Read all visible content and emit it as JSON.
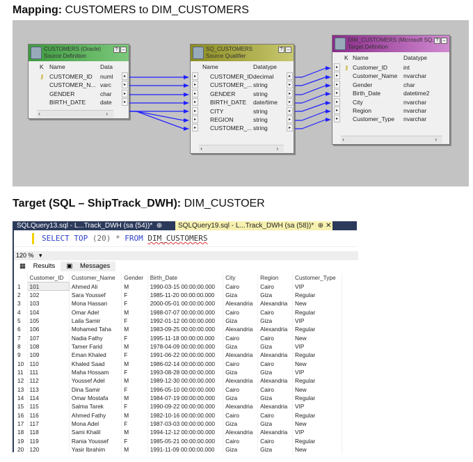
{
  "headings": {
    "mapping_label": "Mapping:",
    "mapping_text": " CUSTOMERS to DIM_CUSTOMERS",
    "target_label": "Target (SQL – ShipTrack_DWH):",
    "target_text": " DIM_CUSTOER"
  },
  "source": {
    "title": "CUSTOMERS (Oracle)",
    "subtitle": "Source Definition",
    "col_k": "K",
    "col_name": "Name",
    "col_type": "Data",
    "rows": [
      {
        "name": "CUSTOMER_ID",
        "type": "numl",
        "key": true
      },
      {
        "name": "CUSTOMER_N...",
        "type": "varc"
      },
      {
        "name": "GENDER",
        "type": "char"
      },
      {
        "name": "BIRTH_DATE",
        "type": "date"
      }
    ]
  },
  "qualifier": {
    "title": "SQ_CUSTOMERS",
    "subtitle": "Source Qualifier",
    "col_name": "Name",
    "col_type": "Datatype",
    "rows": [
      {
        "name": "CUSTOMER_ID",
        "type": "decimal"
      },
      {
        "name": "CUSTOMER_...",
        "type": "string"
      },
      {
        "name": "GENDER",
        "type": "string"
      },
      {
        "name": "BIRTH_DATE",
        "type": "date/time"
      },
      {
        "name": "CITY",
        "type": "string"
      },
      {
        "name": "REGION",
        "type": "string"
      },
      {
        "name": "CUSTOMER_...",
        "type": "string"
      }
    ]
  },
  "target": {
    "title": "DIM_CUSTOMERS (Microsoft SQ...",
    "subtitle": "Target Definition",
    "col_k": "K",
    "col_name": "Name",
    "col_type": "Datatype",
    "rows": [
      {
        "name": "Customer_ID",
        "type": "int",
        "key": true
      },
      {
        "name": "Customer_Name",
        "type": "nvarchar"
      },
      {
        "name": "Gender",
        "type": "char"
      },
      {
        "name": "Birth_Date",
        "type": "datetime2"
      },
      {
        "name": "City",
        "type": "nvarchar"
      },
      {
        "name": "Region",
        "type": "nvarchar"
      },
      {
        "name": "Customer_Type",
        "type": "nvarchar"
      }
    ]
  },
  "ssms": {
    "tab1": "SQLQuery13.sql - L...Track_DWH (sa (54))*",
    "tab2": "SQLQuery19.sql - L...Track_DWH (sa (58))*",
    "query": {
      "k1": "SELECT",
      "k2": "TOP",
      "n": "(20)",
      "star": "*",
      "k3": "FROM",
      "obj": "DIM_CUSTOMERS"
    },
    "zoom": "120 %",
    "results_tab": "Results",
    "messages_tab": "Messages",
    "columns": [
      "",
      "Customer_ID",
      "Customer_Name",
      "Gender",
      "Birth_Date",
      "City",
      "Region",
      "Customer_Type"
    ],
    "rows": [
      [
        "1",
        "101",
        "Ahmed Ali",
        "M",
        "1990-03-15 00:00:00.000",
        "Cairo",
        "Cairo",
        "VIP"
      ],
      [
        "2",
        "102",
        "Sara Youssef",
        "F",
        "1985-11-20 00:00:00.000",
        "Giza",
        "Giza",
        "Regular"
      ],
      [
        "3",
        "103",
        "Mona Hassan",
        "F",
        "2000-05-01 00:00:00.000",
        "Alexandria",
        "Alexandria",
        "New"
      ],
      [
        "4",
        "104",
        "Omar Adel",
        "M",
        "1988-07-07 00:00:00.000",
        "Cairo",
        "Cairo",
        "Regular"
      ],
      [
        "5",
        "105",
        "Laila Samir",
        "F",
        "1992-01-12 00:00:00.000",
        "Giza",
        "Giza",
        "VIP"
      ],
      [
        "6",
        "106",
        "Mohamed Taha",
        "M",
        "1983-09-25 00:00:00.000",
        "Alexandria",
        "Alexandria",
        "Regular"
      ],
      [
        "7",
        "107",
        "Nadia Fathy",
        "F",
        "1995-11-18 00:00:00.000",
        "Cairo",
        "Cairo",
        "New"
      ],
      [
        "8",
        "108",
        "Tamer Farid",
        "M",
        "1978-04-09 00:00:00.000",
        "Giza",
        "Giza",
        "VIP"
      ],
      [
        "9",
        "109",
        "Eman Khaled",
        "F",
        "1991-06-22 00:00:00.000",
        "Alexandria",
        "Alexandria",
        "Regular"
      ],
      [
        "10",
        "110",
        "Khaled Saad",
        "M",
        "1986-02-14 00:00:00.000",
        "Cairo",
        "Cairo",
        "New"
      ],
      [
        "11",
        "111",
        "Maha Hossam",
        "F",
        "1993-08-28 00:00:00.000",
        "Giza",
        "Giza",
        "VIP"
      ],
      [
        "12",
        "112",
        "Youssef Adel",
        "M",
        "1989-12-30 00:00:00.000",
        "Alexandria",
        "Alexandria",
        "Regular"
      ],
      [
        "13",
        "113",
        "Dina Samir",
        "F",
        "1996-05-10 00:00:00.000",
        "Cairo",
        "Cairo",
        "New"
      ],
      [
        "14",
        "114",
        "Omar Mostafa",
        "M",
        "1984-07-19 00:00:00.000",
        "Giza",
        "Giza",
        "Regular"
      ],
      [
        "15",
        "115",
        "Salma Tarek",
        "F",
        "1990-09-22 00:00:00.000",
        "Alexandria",
        "Alexandria",
        "VIP"
      ],
      [
        "16",
        "116",
        "Ahmed Fathy",
        "M",
        "1982-10-16 00:00:00.000",
        "Cairo",
        "Cairo",
        "Regular"
      ],
      [
        "17",
        "117",
        "Mona Adel",
        "F",
        "1987-03-03 00:00:00.000",
        "Giza",
        "Giza",
        "New"
      ],
      [
        "18",
        "118",
        "Sami Khalil",
        "M",
        "1994-12-12 00:00:00.000",
        "Alexandria",
        "Alexandria",
        "VIP"
      ],
      [
        "19",
        "119",
        "Rania Youssef",
        "F",
        "1985-05-21 00:00:00.000",
        "Cairo",
        "Cairo",
        "Regular"
      ],
      [
        "20",
        "120",
        "Yasir Ibrahim",
        "M",
        "1991-11-09 00:00:00.000",
        "Giza",
        "Giza",
        "New"
      ]
    ]
  },
  "colors": {
    "source_header": "#5fb25f",
    "qualifier_header": "#9a9a30",
    "target_header": "#a040a0",
    "link": "#2020ff",
    "tab_bar": "#2b3a5b",
    "active_tab": "#f7f1b0"
  }
}
